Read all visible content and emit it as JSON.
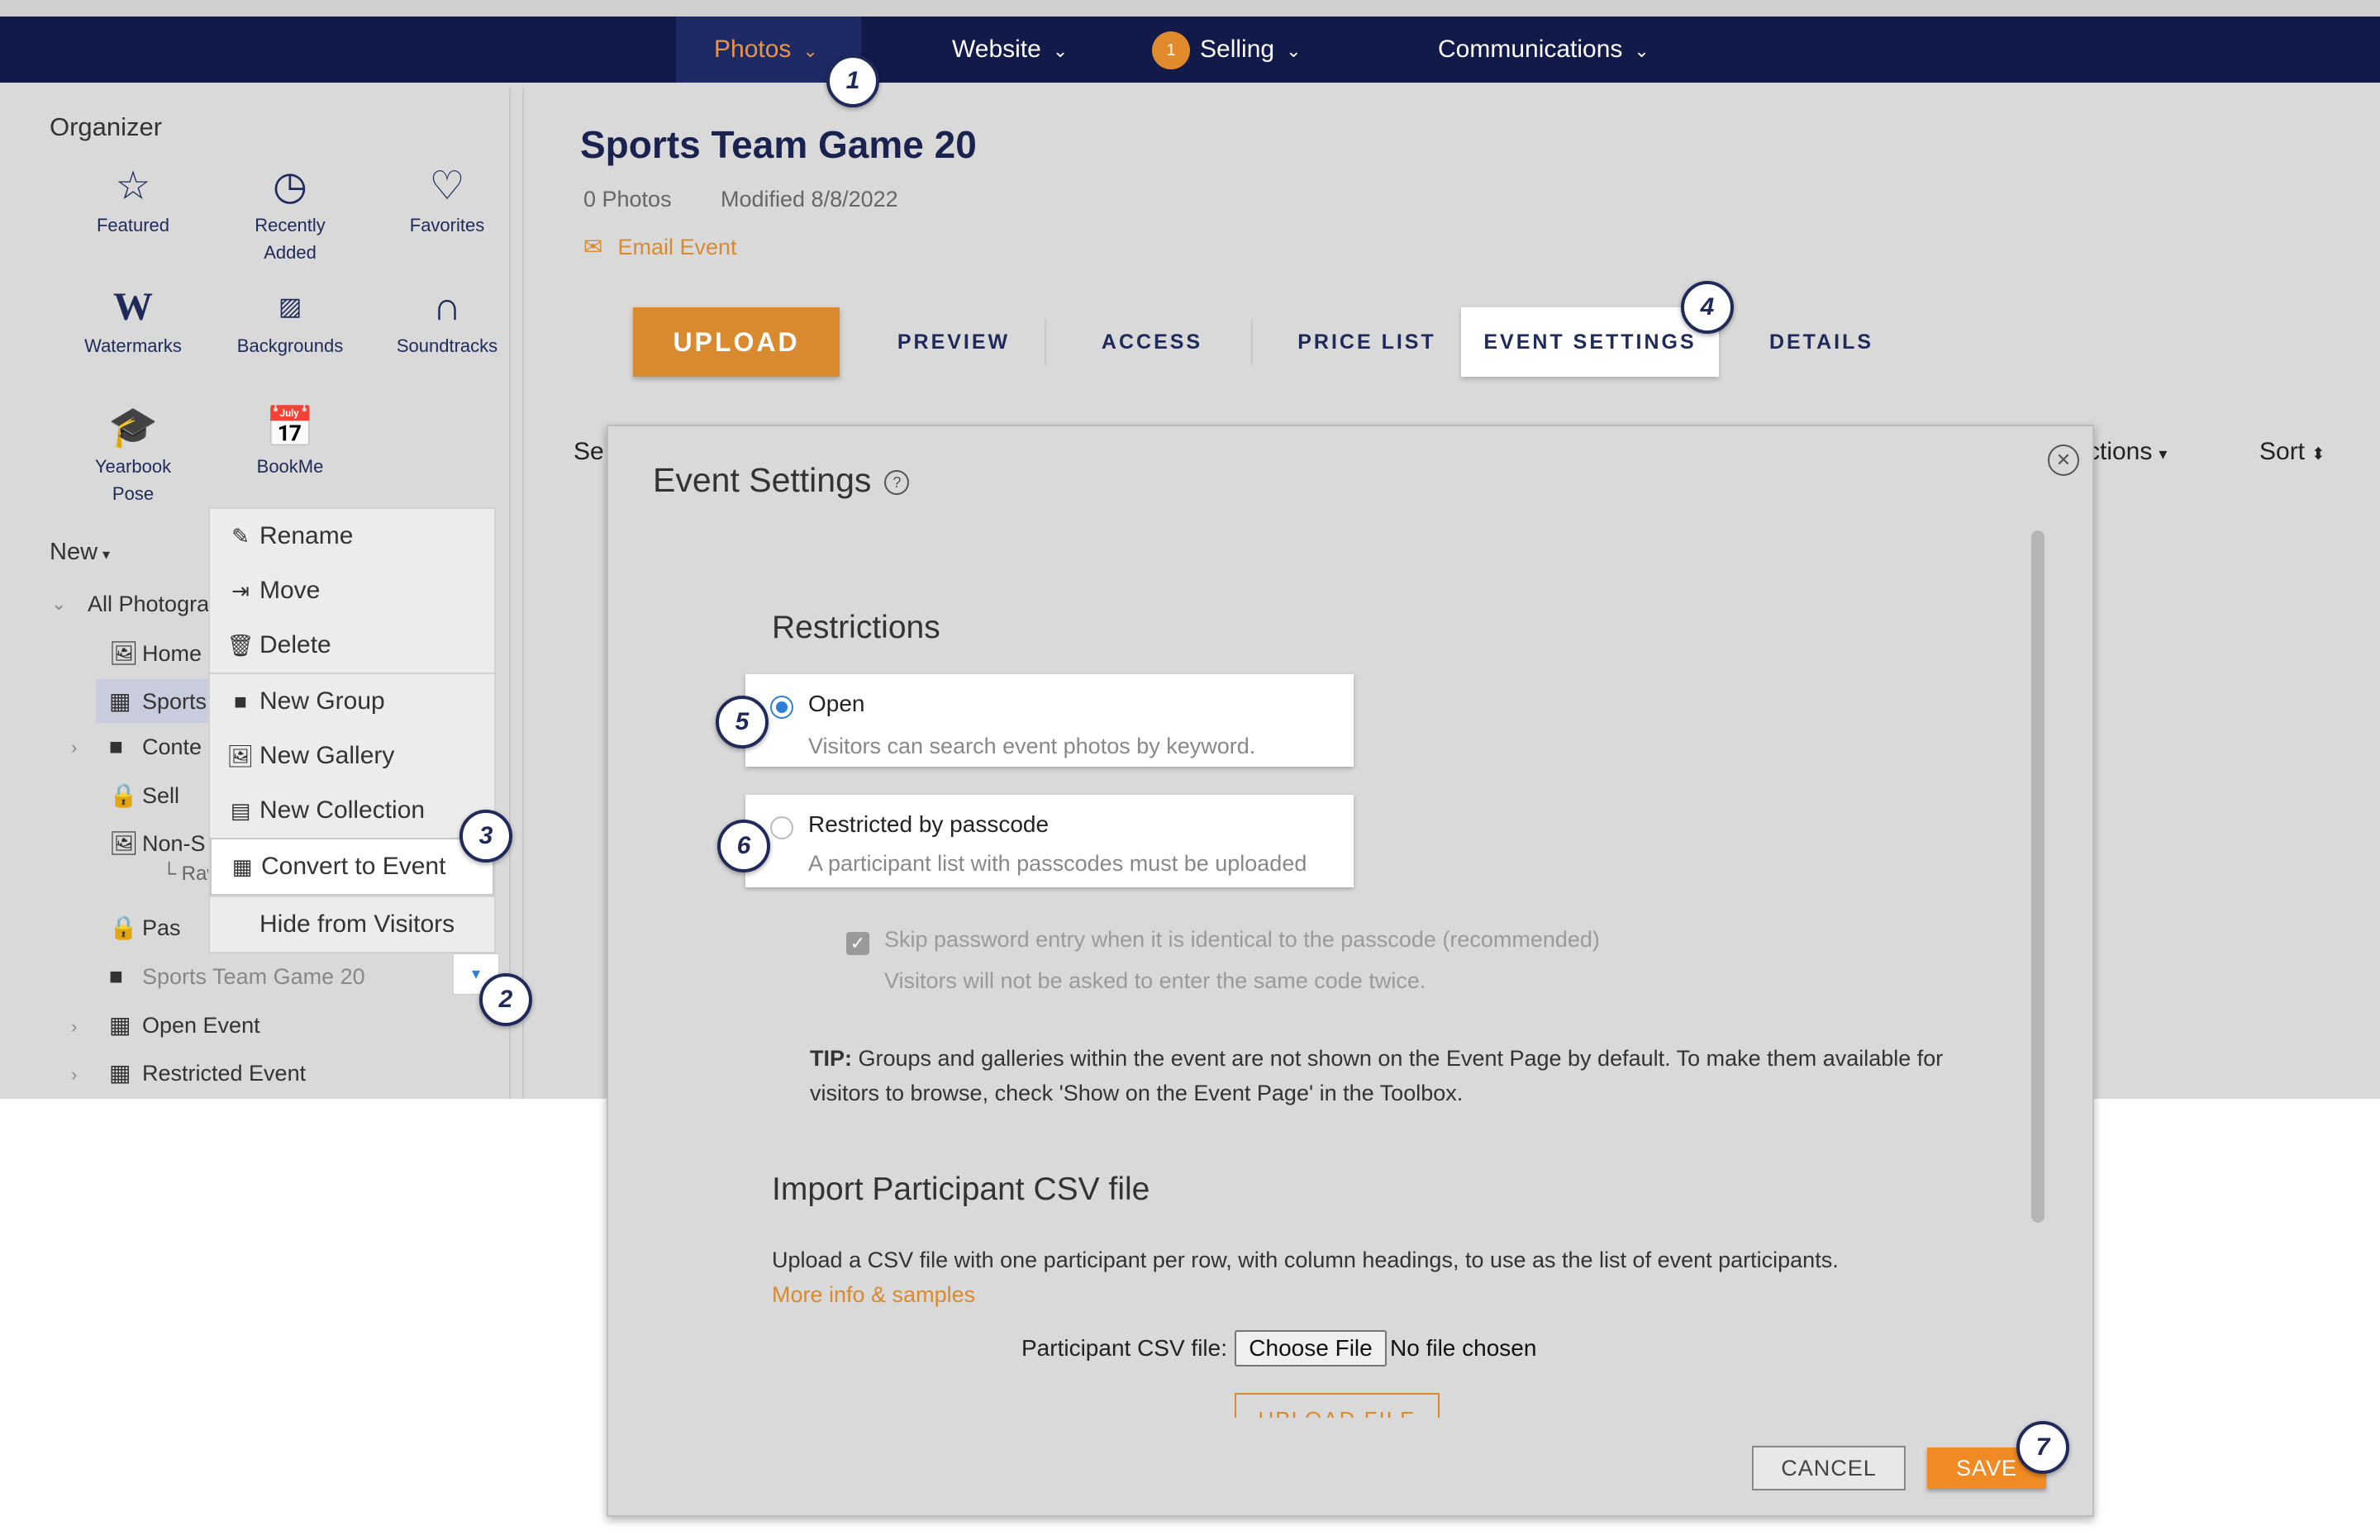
{
  "colors": {
    "nav_bg": "#121a4a",
    "accent_orange": "#d98a2e",
    "marker_navy": "#1f2a5a",
    "radio_blue": "#2f7fd6"
  },
  "nav": {
    "items": [
      {
        "label": "Photos",
        "icon": "chevron-down-icon"
      },
      {
        "label": "Website",
        "icon": "chevron-down-icon"
      },
      {
        "label": "Selling",
        "badge": "1",
        "icon": "chevron-down-icon"
      },
      {
        "label": "Communications",
        "icon": "chevron-down-icon"
      }
    ]
  },
  "organizer": {
    "title": "Organizer",
    "tiles": [
      {
        "label": "Featured",
        "icon": "star-icon"
      },
      {
        "label": "Recently Added",
        "icon": "clock-icon"
      },
      {
        "label": "Favorites",
        "icon": "heart-icon"
      },
      {
        "label": "Watermarks",
        "icon": "watermark-w-icon"
      },
      {
        "label": "Backgrounds",
        "icon": "backgrounds-icon"
      },
      {
        "label": "Soundtracks",
        "icon": "headphones-icon"
      },
      {
        "label": "Yearbook Pose",
        "icon": "graduation-cap-icon"
      },
      {
        "label": "BookMe",
        "icon": "calendar-check-icon"
      }
    ],
    "new_label": "New"
  },
  "tree": {
    "root": "All Photogra",
    "items": [
      {
        "label": "Home",
        "icon": "gallery-icon"
      },
      {
        "label": "Sports",
        "icon": "calendar-icon"
      },
      {
        "label": "Conte",
        "icon": "folder-icon"
      },
      {
        "label": "Sell",
        "icon": "gallery-lock-icon"
      },
      {
        "label": "Non-S",
        "icon": "gallery-icon",
        "sub": "Raw"
      },
      {
        "label": "Pas",
        "icon": "gallery-lock-icon"
      },
      {
        "label": "Sports Team Game 20",
        "icon": "folder-icon"
      },
      {
        "label": "Open Event",
        "icon": "calendar-icon"
      },
      {
        "label": "Restricted Event",
        "icon": "calendar-icon"
      }
    ]
  },
  "context_menu": {
    "items": [
      {
        "label": "Rename",
        "icon": "pencil-icon"
      },
      {
        "label": "Move",
        "icon": "move-icon"
      },
      {
        "label": "Delete",
        "icon": "trash-icon"
      },
      {
        "label": "New Group",
        "icon": "folder-icon"
      },
      {
        "label": "New Gallery",
        "icon": "gallery-icon"
      },
      {
        "label": "New Collection",
        "icon": "collection-icon"
      },
      {
        "label": "Convert to Event",
        "icon": "calendar-icon"
      },
      {
        "label": "Hide from Visitors",
        "icon": ""
      }
    ]
  },
  "markers": [
    "1",
    "2",
    "3",
    "4",
    "5",
    "6",
    "7"
  ],
  "event": {
    "title": "Sports Team Game 20",
    "photos": "0 Photos",
    "modified": "Modified 8/8/2022",
    "email": "Email Event"
  },
  "tabs": {
    "upload": "UPLOAD",
    "preview": "PREVIEW",
    "access": "ACCESS",
    "price_list": "PRICE LIST",
    "event_settings": "EVENT SETTINGS",
    "details": "DETAILS"
  },
  "toolbar": {
    "select_partial": "Se",
    "actions_partial": "ctions",
    "sort": "Sort"
  },
  "modal": {
    "title": "Event Settings",
    "restrictions_heading": "Restrictions",
    "open_label": "Open",
    "open_desc": "Visitors can search event photos by keyword.",
    "open_selected": true,
    "restricted_label": "Restricted by passcode",
    "restricted_desc": "A participant list with passcodes must be uploaded",
    "skip_label": "Skip password entry when it is identical to the passcode (recommended)",
    "skip_desc": "Visitors will not be asked to enter the same code twice.",
    "skip_checked": true,
    "tip_label": "TIP:",
    "tip_text": " Groups and galleries within the event are not shown on the Event Page by default. To make them available for visitors to browse, check 'Show on the Event Page' in the Toolbox.",
    "import_heading": "Import Participant CSV file",
    "import_desc": "Upload a CSV file with one participant per row, with column headings, to use as the list of event participants.",
    "more_info": "More info & samples",
    "file_label": "Participant CSV file:",
    "choose_file": "Choose File",
    "no_file": "No file chosen",
    "upload_file": "UPLOAD FILE",
    "cancel": "CANCEL",
    "save": "SAVE"
  }
}
